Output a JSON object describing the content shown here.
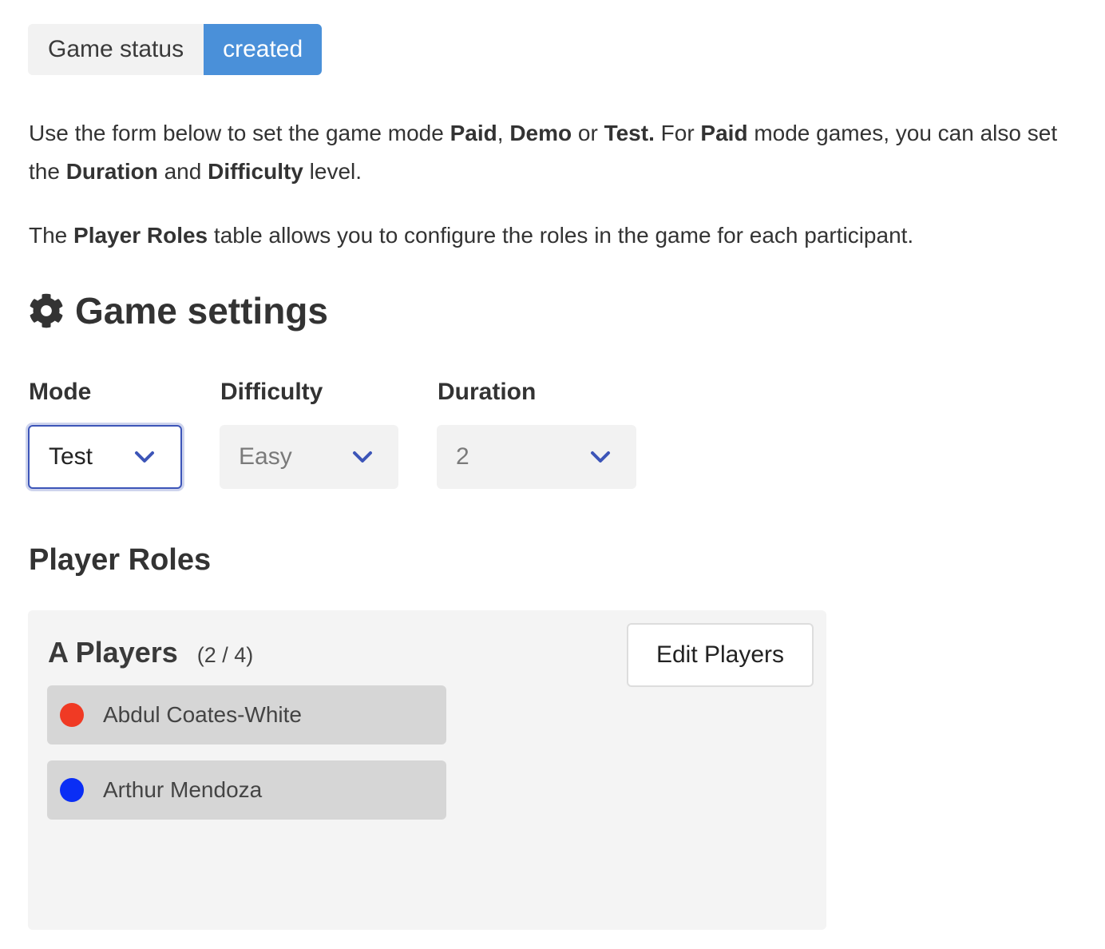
{
  "status": {
    "label": "Game status",
    "value": "created",
    "accent_color": "#4a90d9"
  },
  "intro": {
    "p1": {
      "t1": "Use the form below to set the game mode ",
      "paid": "Paid",
      "t2": ", ",
      "demo": "Demo",
      "t3": " or ",
      "test": "Test.",
      "t4": " For ",
      "paid2": "Paid",
      "t5": " mode games, you can also set the ",
      "duration": "Duration",
      "t6": " and ",
      "difficulty": "Difficulty",
      "t7": " level."
    },
    "p2": {
      "t1": "The ",
      "roles": "Player Roles",
      "t2": " table allows you to configure the roles in the game for each participant."
    }
  },
  "settings": {
    "title": "Game settings",
    "icon": "gear-icon",
    "mode": {
      "label": "Mode",
      "value": "Test"
    },
    "difficulty": {
      "label": "Difficulty",
      "value": "Easy"
    },
    "duration": {
      "label": "Duration",
      "value": "2"
    }
  },
  "roles": {
    "title": "Player Roles",
    "group": {
      "name": "A Players",
      "count": "(2 / 4)",
      "edit_label": "Edit Players",
      "players": [
        {
          "name": "Abdul Coates-White",
          "color": "#f03a24"
        },
        {
          "name": "Arthur Mendoza",
          "color": "#0a2ef5"
        }
      ]
    }
  }
}
